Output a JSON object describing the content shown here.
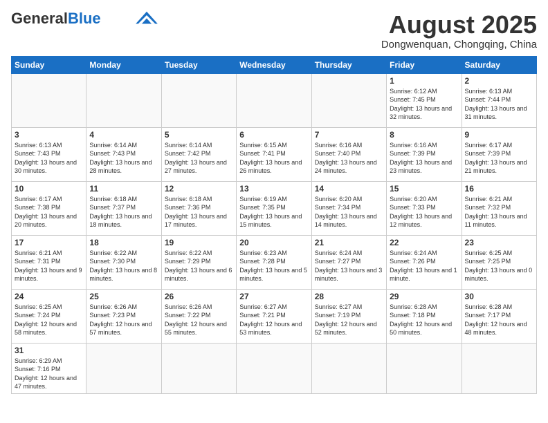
{
  "header": {
    "logo_general": "General",
    "logo_blue": "Blue",
    "month_title": "August 2025",
    "subtitle": "Dongwenquan, Chongqing, China"
  },
  "days_of_week": [
    "Sunday",
    "Monday",
    "Tuesday",
    "Wednesday",
    "Thursday",
    "Friday",
    "Saturday"
  ],
  "weeks": [
    [
      {
        "num": "",
        "info": ""
      },
      {
        "num": "",
        "info": ""
      },
      {
        "num": "",
        "info": ""
      },
      {
        "num": "",
        "info": ""
      },
      {
        "num": "",
        "info": ""
      },
      {
        "num": "1",
        "info": "Sunrise: 6:12 AM\nSunset: 7:45 PM\nDaylight: 13 hours and 32 minutes."
      },
      {
        "num": "2",
        "info": "Sunrise: 6:13 AM\nSunset: 7:44 PM\nDaylight: 13 hours and 31 minutes."
      }
    ],
    [
      {
        "num": "3",
        "info": "Sunrise: 6:13 AM\nSunset: 7:43 PM\nDaylight: 13 hours and 30 minutes."
      },
      {
        "num": "4",
        "info": "Sunrise: 6:14 AM\nSunset: 7:43 PM\nDaylight: 13 hours and 28 minutes."
      },
      {
        "num": "5",
        "info": "Sunrise: 6:14 AM\nSunset: 7:42 PM\nDaylight: 13 hours and 27 minutes."
      },
      {
        "num": "6",
        "info": "Sunrise: 6:15 AM\nSunset: 7:41 PM\nDaylight: 13 hours and 26 minutes."
      },
      {
        "num": "7",
        "info": "Sunrise: 6:16 AM\nSunset: 7:40 PM\nDaylight: 13 hours and 24 minutes."
      },
      {
        "num": "8",
        "info": "Sunrise: 6:16 AM\nSunset: 7:39 PM\nDaylight: 13 hours and 23 minutes."
      },
      {
        "num": "9",
        "info": "Sunrise: 6:17 AM\nSunset: 7:39 PM\nDaylight: 13 hours and 21 minutes."
      }
    ],
    [
      {
        "num": "10",
        "info": "Sunrise: 6:17 AM\nSunset: 7:38 PM\nDaylight: 13 hours and 20 minutes."
      },
      {
        "num": "11",
        "info": "Sunrise: 6:18 AM\nSunset: 7:37 PM\nDaylight: 13 hours and 18 minutes."
      },
      {
        "num": "12",
        "info": "Sunrise: 6:18 AM\nSunset: 7:36 PM\nDaylight: 13 hours and 17 minutes."
      },
      {
        "num": "13",
        "info": "Sunrise: 6:19 AM\nSunset: 7:35 PM\nDaylight: 13 hours and 15 minutes."
      },
      {
        "num": "14",
        "info": "Sunrise: 6:20 AM\nSunset: 7:34 PM\nDaylight: 13 hours and 14 minutes."
      },
      {
        "num": "15",
        "info": "Sunrise: 6:20 AM\nSunset: 7:33 PM\nDaylight: 13 hours and 12 minutes."
      },
      {
        "num": "16",
        "info": "Sunrise: 6:21 AM\nSunset: 7:32 PM\nDaylight: 13 hours and 11 minutes."
      }
    ],
    [
      {
        "num": "17",
        "info": "Sunrise: 6:21 AM\nSunset: 7:31 PM\nDaylight: 13 hours and 9 minutes."
      },
      {
        "num": "18",
        "info": "Sunrise: 6:22 AM\nSunset: 7:30 PM\nDaylight: 13 hours and 8 minutes."
      },
      {
        "num": "19",
        "info": "Sunrise: 6:22 AM\nSunset: 7:29 PM\nDaylight: 13 hours and 6 minutes."
      },
      {
        "num": "20",
        "info": "Sunrise: 6:23 AM\nSunset: 7:28 PM\nDaylight: 13 hours and 5 minutes."
      },
      {
        "num": "21",
        "info": "Sunrise: 6:24 AM\nSunset: 7:27 PM\nDaylight: 13 hours and 3 minutes."
      },
      {
        "num": "22",
        "info": "Sunrise: 6:24 AM\nSunset: 7:26 PM\nDaylight: 13 hours and 1 minute."
      },
      {
        "num": "23",
        "info": "Sunrise: 6:25 AM\nSunset: 7:25 PM\nDaylight: 13 hours and 0 minutes."
      }
    ],
    [
      {
        "num": "24",
        "info": "Sunrise: 6:25 AM\nSunset: 7:24 PM\nDaylight: 12 hours and 58 minutes."
      },
      {
        "num": "25",
        "info": "Sunrise: 6:26 AM\nSunset: 7:23 PM\nDaylight: 12 hours and 57 minutes."
      },
      {
        "num": "26",
        "info": "Sunrise: 6:26 AM\nSunset: 7:22 PM\nDaylight: 12 hours and 55 minutes."
      },
      {
        "num": "27",
        "info": "Sunrise: 6:27 AM\nSunset: 7:21 PM\nDaylight: 12 hours and 53 minutes."
      },
      {
        "num": "28",
        "info": "Sunrise: 6:27 AM\nSunset: 7:19 PM\nDaylight: 12 hours and 52 minutes."
      },
      {
        "num": "29",
        "info": "Sunrise: 6:28 AM\nSunset: 7:18 PM\nDaylight: 12 hours and 50 minutes."
      },
      {
        "num": "30",
        "info": "Sunrise: 6:28 AM\nSunset: 7:17 PM\nDaylight: 12 hours and 48 minutes."
      }
    ],
    [
      {
        "num": "31",
        "info": "Sunrise: 6:29 AM\nSunset: 7:16 PM\nDaylight: 12 hours and 47 minutes."
      },
      {
        "num": "",
        "info": ""
      },
      {
        "num": "",
        "info": ""
      },
      {
        "num": "",
        "info": ""
      },
      {
        "num": "",
        "info": ""
      },
      {
        "num": "",
        "info": ""
      },
      {
        "num": "",
        "info": ""
      }
    ]
  ]
}
